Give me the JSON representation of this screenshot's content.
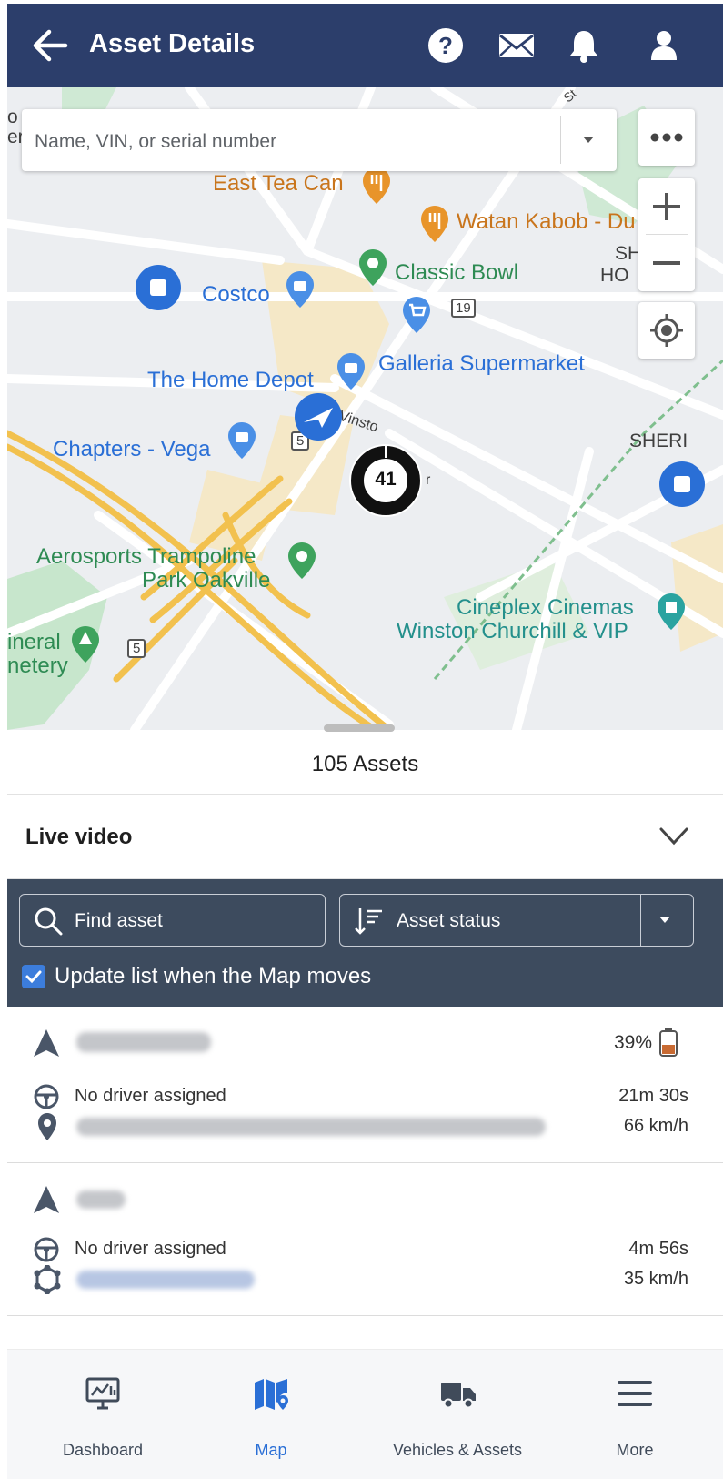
{
  "header": {
    "title": "Asset Details",
    "icons": [
      "back-arrow-icon",
      "help-icon",
      "mail-icon",
      "bell-icon",
      "user-icon"
    ]
  },
  "map": {
    "search_placeholder": "Name, VIN, or serial number",
    "cluster_count": "41",
    "controls": [
      "more-icon",
      "zoom-in-icon",
      "zoom-out-icon",
      "locate-icon"
    ],
    "labels": {
      "east_tea": "East Tea Can",
      "watan": "Watan Kabob - Du",
      "classic_bowl": "Classic Bowl",
      "costco": "Costco",
      "galleria": "Galleria Supermarket",
      "home_depot": "The Home Depot",
      "chapters": "Chapters - Vega",
      "aerosports_1": "Aerosports Trampoline",
      "aerosports_2": "Park Oakville",
      "cineplex_1": "Cineplex Cinemas",
      "cineplex_2": "Winston Churchill & VIP",
      "funeral_1": "ineral",
      "funeral_2": "netery",
      "sheri_1": "SH",
      "sheri_2": "HO",
      "sherid": "SHERI",
      "road_19": "19",
      "road_5a": "5",
      "road_5b": "5",
      "winston": "Vinsto",
      "edge_1": "o",
      "edge_2": "er",
      "st": "St",
      "dr": "r"
    }
  },
  "sheet": {
    "asset_count": "105 Assets",
    "live_video": "Live video"
  },
  "filters": {
    "find_label": "Find asset",
    "status_label": "Asset status",
    "update_label": "Update list when the Map moves",
    "update_checked": true
  },
  "assets": [
    {
      "battery": "39%",
      "battery_level": 0.39,
      "driver": "No driver assigned",
      "duration": "21m 30s",
      "speed": "66 km/h"
    },
    {
      "driver": "No driver assigned",
      "duration": "4m 56s",
      "speed": "35 km/h"
    }
  ],
  "bottom_nav": [
    {
      "label": "Dashboard",
      "icon": "dashboard-icon",
      "active": false
    },
    {
      "label": "Map",
      "icon": "map-icon",
      "active": true
    },
    {
      "label": "Vehicles & Assets",
      "icon": "truck-icon",
      "active": false
    },
    {
      "label": "More",
      "icon": "menu-icon",
      "active": false
    }
  ],
  "colors": {
    "header_bg": "#2c3e6b",
    "filter_bg": "#3d4b5e",
    "accent_blue": "#2a6fd6",
    "nav_active": "#2a6fd6"
  }
}
